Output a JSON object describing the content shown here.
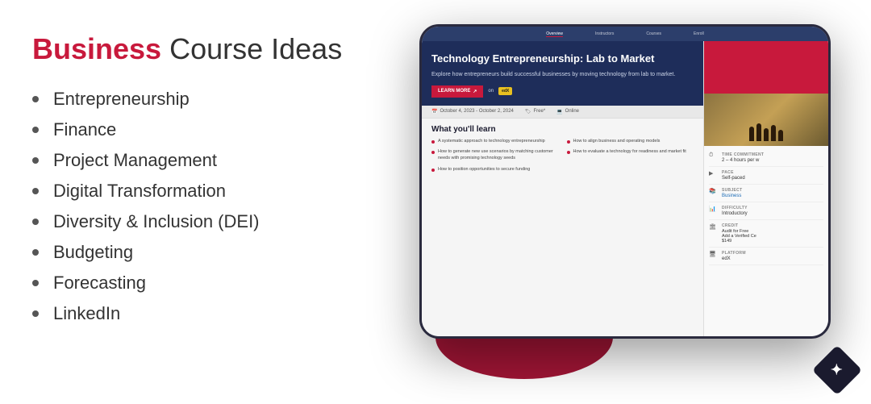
{
  "header": {
    "title_bold": "Business",
    "title_rest": "Course Ideas"
  },
  "course_list": {
    "items": [
      {
        "label": "Entrepreneurship"
      },
      {
        "label": "Finance"
      },
      {
        "label": "Project Management"
      },
      {
        "label": "Digital Transformation"
      },
      {
        "label": "Diversity & Inclusion (DEI)"
      },
      {
        "label": "Budgeting"
      },
      {
        "label": "Forecasting"
      },
      {
        "label": "LinkedIn"
      }
    ]
  },
  "tablet": {
    "course_title": "Technology Entrepreneurship: Lab to Market",
    "course_desc": "Explore how entrepreneurs build successful businesses by moving technology from lab to market.",
    "cta_label": "LEARN MORE",
    "on_platform": "on",
    "platform_badge": "edX",
    "dates": "October 4, 2023 - October 2, 2024",
    "price": "Free*",
    "mode": "Online",
    "learn_title": "What you'll learn",
    "learn_items": [
      "A systematic approach to technology entrepreneurship",
      "How to generate new use scenarios by matching customer needs with promising technology seeds",
      "How to align business and operating models",
      "How to evaluate a technology for readiness and market fit",
      "How to position opportunities to secure funding"
    ],
    "info_rows": [
      {
        "icon": "⏱",
        "label": "TIME COMMITMENT",
        "value": "2 – 4 hours per w"
      },
      {
        "icon": "▶",
        "label": "PACE",
        "value": "Self-paced"
      },
      {
        "icon": "📚",
        "label": "SUBJECT",
        "value": "Business",
        "accent": true
      },
      {
        "icon": "📊",
        "label": "DIFFICULTY",
        "value": "Introductory"
      },
      {
        "icon": "🏛",
        "label": "CREDIT",
        "value": "Audit for Free\nAdd a Verified Ce\n$149"
      },
      {
        "icon": "🖥",
        "label": "PLATFORM",
        "value": "edX"
      }
    ],
    "nav_items": [
      "Overview",
      "Instructors",
      "Courses",
      "Enroll"
    ]
  },
  "logo": {
    "symbol": "✦"
  }
}
